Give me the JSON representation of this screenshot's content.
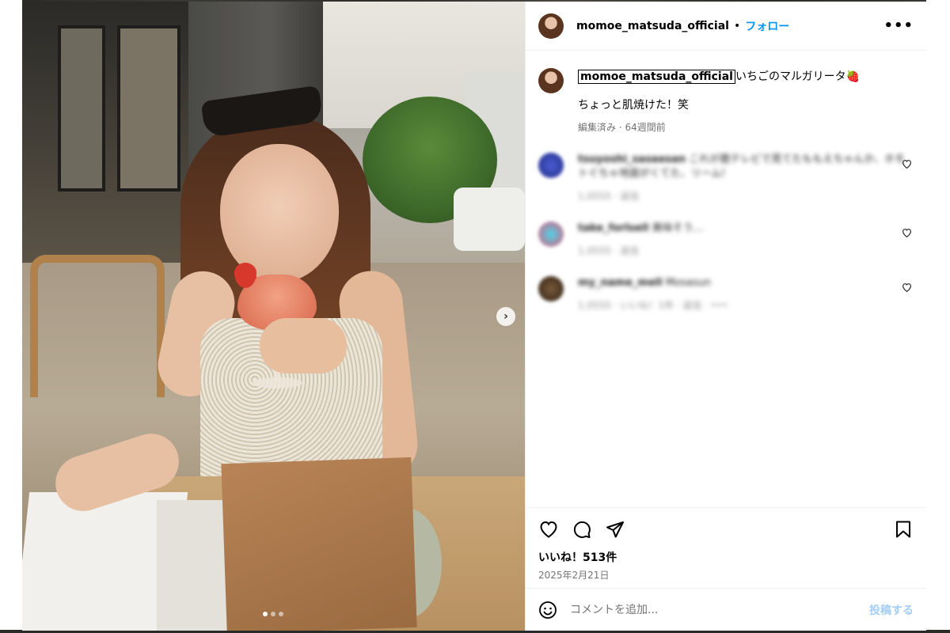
{
  "header": {
    "username": "momoe_matsuda_official",
    "separator": "•",
    "follow_label": "フォロー",
    "more_label": "•••"
  },
  "caption": {
    "username": "momoe_matsuda_official",
    "text": "いちごのマルガリータ🍓",
    "second_line": "ちょっと肌焼けた！笑",
    "meta": "編集済み · 64週間前"
  },
  "comments": [
    {
      "username": "tsuyoshi_sasaesan",
      "text": "これが鹿テレビで見てたももえちゃんか、ホモトぐちゃ地面がくてた、リーム!",
      "meta": "1,0555 · 返信",
      "like_icon": "heart-outline-icon"
    },
    {
      "username": "take_forlsell",
      "text": "美味そう…",
      "meta": "1,0555 · 返信",
      "like_icon": "heart-outline-icon"
    },
    {
      "username": "my_name_mell",
      "text": "Mosasun",
      "meta": "1,0555 · いいね！1件 · 返信 · •••",
      "like_icon": "heart-outline-icon"
    }
  ],
  "actions": {
    "likes": "いいね！513件",
    "date": "2025年2月21日"
  },
  "add_comment": {
    "placeholder": "コメントを追加...",
    "post_label": "投稿する"
  },
  "carousel": {
    "next_label": "›",
    "dot_count": 3,
    "active_index": 0
  },
  "colors": {
    "accent": "#0095f6",
    "post_disabled": "#a3cdf7",
    "meta_text": "#737373",
    "divider": "#efefef"
  }
}
